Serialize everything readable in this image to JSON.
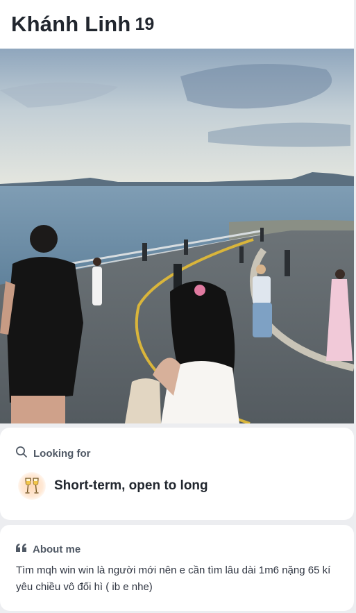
{
  "profile": {
    "name": "Khánh Linh",
    "age": "19"
  },
  "photo": {
    "description_icon": "profile-photo"
  },
  "looking_for": {
    "title": "Looking for",
    "icon": "search-icon",
    "value_icon": "champagne-glasses-icon",
    "value": "Short-term, open to long"
  },
  "about_me": {
    "title": "About me",
    "icon": "quote-icon",
    "text": "Tìm mqh win win là người mới nên e cần tìm lâu dài 1m6 nặng 65 kí yêu chiều vô đối hì ( ib e nhe)"
  },
  "colors": {
    "background": "#ecedf0",
    "card": "#ffffff",
    "text": "#21262e",
    "muted": "#505965"
  }
}
